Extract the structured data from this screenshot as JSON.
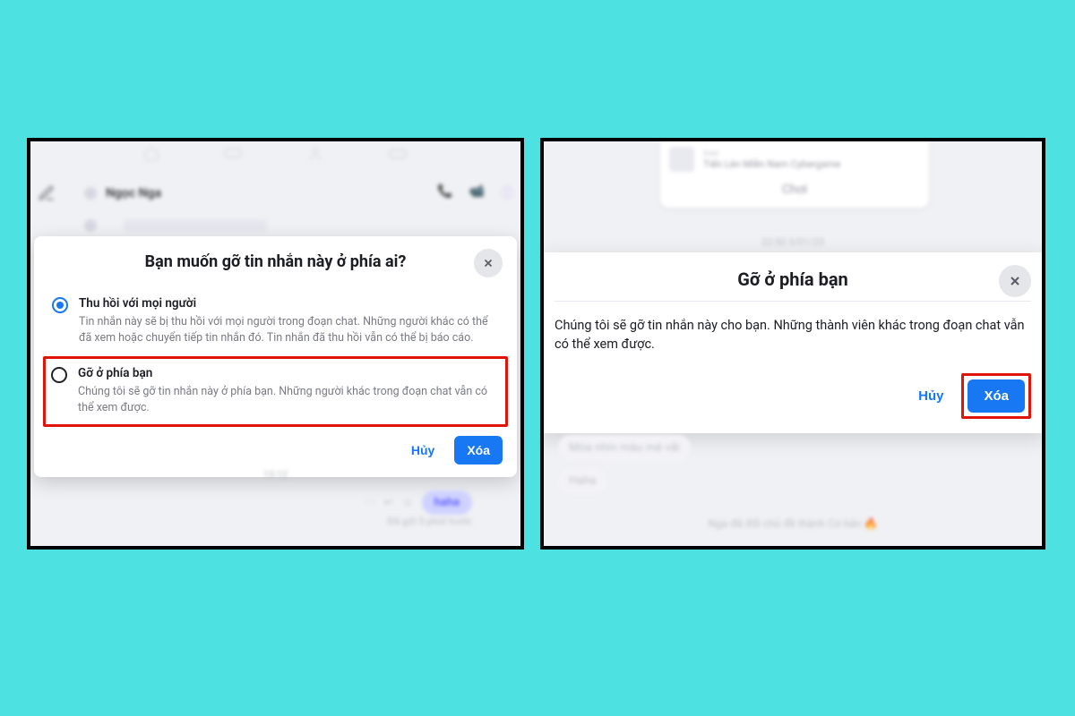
{
  "left": {
    "chat_name": "Ngọc Nga",
    "dialog_title": "Bạn muốn gỡ tin nhắn này ở phía ai?",
    "opt1": {
      "title": "Thu hồi với mọi người",
      "desc": "Tin nhắn này sẽ bị thu hồi với mọi người trong đoạn chat. Những người khác có thể đã xem hoặc chuyển tiếp tin nhắn đó. Tin nhắn đã thu hồi vẫn có thể bị báo cáo."
    },
    "opt2": {
      "title": "Gỡ ở phía bạn",
      "desc": "Chúng tôi sẽ gỡ tin nhắn này ở phía bạn. Những người khác trong đoạn chat vẫn có thể xem được."
    },
    "cancel": "Hủy",
    "delete": "Xóa",
    "timestamp": "15:12",
    "bubble_text": "haha",
    "sent_ago": "Đã gửi 5 phút trước"
  },
  "right": {
    "game_icon_label": "Icon",
    "game_name": "Tiến Lên Miền Nam Cybergame",
    "play_label": "Chơi",
    "timestamp": "22:50 3/01/23",
    "dialog_title": "Gỡ ở phía bạn",
    "dialog_body": "Chúng tôi sẽ gỡ tin nhắn này cho bạn. Những thành viên khác trong đoạn chat vẫn có thể xem được.",
    "cancel": "Hủy",
    "delete": "Xóa",
    "msg1": "Móa nhìn màu mè vãi",
    "msg2": "Haha",
    "theme_change": "Nga đã đổi chủ đề thành Cơ bản 🔥"
  }
}
